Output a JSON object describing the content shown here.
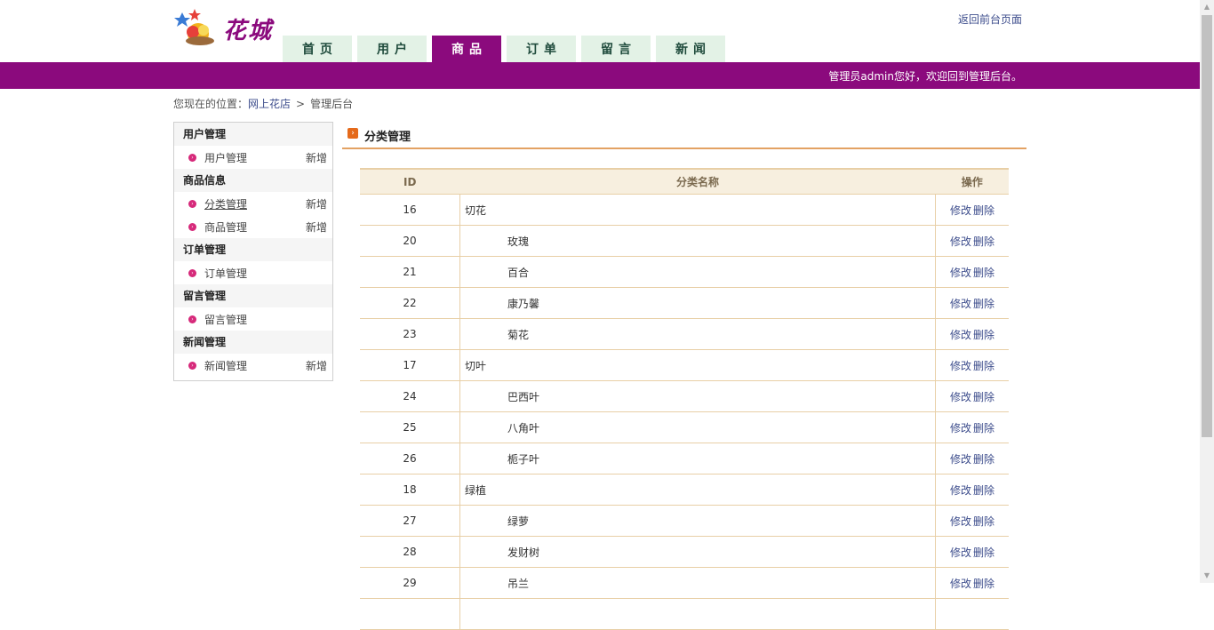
{
  "header": {
    "logo_text": "花城",
    "back_link": "返回前台页面",
    "welcome": "管理员admin您好，欢迎回到管理后台。",
    "nav": [
      {
        "label": "首页",
        "active": false
      },
      {
        "label": "用户",
        "active": false
      },
      {
        "label": "商品",
        "active": true
      },
      {
        "label": "订单",
        "active": false
      },
      {
        "label": "留言",
        "active": false
      },
      {
        "label": "新闻",
        "active": false
      }
    ]
  },
  "breadcrumb": {
    "prefix": "您现在的位置：",
    "home": "网上花店",
    "separator": ">",
    "current": "管理后台"
  },
  "sidebar": {
    "groups": [
      {
        "title": "用户管理",
        "items": [
          {
            "label": "用户管理",
            "add": "新增"
          }
        ]
      },
      {
        "title": "商品信息",
        "items": [
          {
            "label": "分类管理",
            "add": "新增"
          },
          {
            "label": "商品管理",
            "add": "新增"
          }
        ]
      },
      {
        "title": "订单管理",
        "items": [
          {
            "label": "订单管理",
            "add": ""
          }
        ]
      },
      {
        "title": "留言管理",
        "items": [
          {
            "label": "留言管理",
            "add": ""
          }
        ]
      },
      {
        "title": "新闻管理",
        "items": [
          {
            "label": "新闻管理",
            "add": "新增"
          }
        ]
      }
    ]
  },
  "main": {
    "title": "分类管理",
    "table": {
      "headers": {
        "id": "ID",
        "name": "分类名称",
        "ops": "操作"
      },
      "edit_label": "修改",
      "delete_label": "删除",
      "rows": [
        {
          "id": "16",
          "name": "切花",
          "child": false
        },
        {
          "id": "20",
          "name": "玫瑰",
          "child": true
        },
        {
          "id": "21",
          "name": "百合",
          "child": true
        },
        {
          "id": "22",
          "name": "康乃馨",
          "child": true
        },
        {
          "id": "23",
          "name": "菊花",
          "child": true
        },
        {
          "id": "17",
          "name": "切叶",
          "child": false
        },
        {
          "id": "24",
          "name": "巴西叶",
          "child": true
        },
        {
          "id": "25",
          "name": "八角叶",
          "child": true
        },
        {
          "id": "26",
          "name": "栀子叶",
          "child": true
        },
        {
          "id": "18",
          "name": "绿植",
          "child": false
        },
        {
          "id": "27",
          "name": "绿萝",
          "child": true
        },
        {
          "id": "28",
          "name": "发财树",
          "child": true
        },
        {
          "id": "29",
          "name": "吊兰",
          "child": true
        },
        {
          "id": "",
          "name": "",
          "child": false
        }
      ]
    }
  },
  "colors": {
    "brand": "#8b0a7d",
    "nav_bg": "#e3f2e6",
    "table_border": "#e8cfa6",
    "bullet": "#d6297a"
  }
}
